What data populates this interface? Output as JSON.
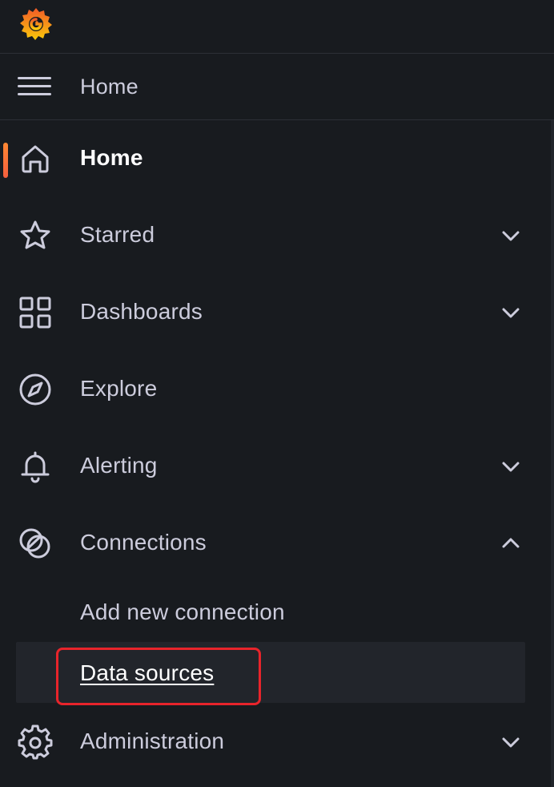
{
  "header": {
    "logo": "grafana-logo-icon",
    "breadcrumb": "Home",
    "menu_icon": "hamburger-menu-icon"
  },
  "nav": {
    "items": [
      {
        "label": "Home",
        "icon": "home-icon",
        "active": true
      },
      {
        "label": "Starred",
        "icon": "star-icon",
        "expandable": true
      },
      {
        "label": "Dashboards",
        "icon": "grid-icon",
        "expandable": true
      },
      {
        "label": "Explore",
        "icon": "compass-icon"
      },
      {
        "label": "Alerting",
        "icon": "bell-icon",
        "expandable": true
      },
      {
        "label": "Connections",
        "icon": "connections-icon",
        "expanded": true,
        "children": [
          {
            "label": "Add new connection"
          },
          {
            "label": "Data sources",
            "selected": true,
            "highlighted": true
          }
        ]
      },
      {
        "label": "Administration",
        "icon": "gear-icon",
        "expandable": true
      }
    ]
  },
  "colors": {
    "background": "#181b1f",
    "text": "#ccccdc",
    "active_text": "#ffffff",
    "accent": "#f55f3e",
    "selected_bg": "#22252b",
    "highlight_border": "#e8242b"
  }
}
